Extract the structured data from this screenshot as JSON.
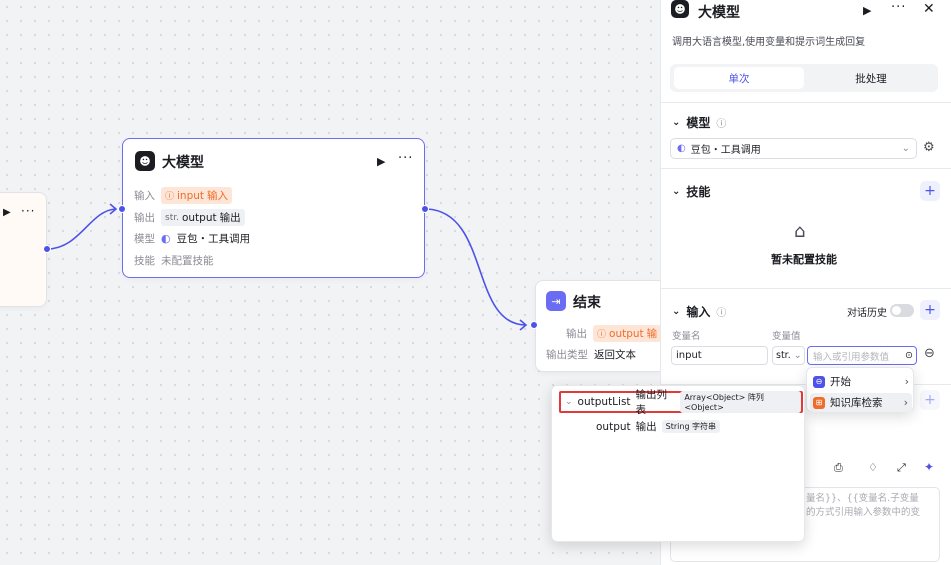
{
  "canvas": {
    "left_node": {
      "run_icon": "play-icon",
      "more_icon": "more-icon"
    },
    "llm_node": {
      "title": "大模型",
      "input_label": "输入",
      "input_tag": "input",
      "input_value": "输入",
      "output_label": "输出",
      "output_type": "str.",
      "output_name": "output",
      "output_value": "输出",
      "model_label": "模型",
      "model_value": "豆包・工具调用",
      "skill_label": "技能",
      "skill_value": "未配置技能"
    },
    "end_node": {
      "title": "结束",
      "output_label": "输出",
      "output_tag": "output",
      "output_value": "输",
      "output_type_label": "输出类型",
      "output_type_value": "返回文本"
    },
    "output_popup": {
      "items": [
        {
          "name": "outputList",
          "desc": "输出列表",
          "type": "Array<Object> 阵列<Object>"
        },
        {
          "name": "output",
          "desc": "输出",
          "type": "String 字符串"
        }
      ]
    }
  },
  "panel": {
    "title": "大模型",
    "description": "调用大语言模型,使用变量和提示词生成回复",
    "tabs": [
      "单次",
      "批处理"
    ],
    "model_section": {
      "title": "模型",
      "selected": "豆包・工具调用"
    },
    "skills_section": {
      "title": "技能",
      "empty_text": "暂未配置技能"
    },
    "input_section": {
      "title": "输入",
      "history_label": "对话历史",
      "col_name": "变量名",
      "col_value": "变量值",
      "row": {
        "name": "input",
        "type": "str.",
        "placeholder": "输入或引用参数值"
      }
    },
    "ref_menu": {
      "items": [
        "开始",
        "知识库检索"
      ]
    },
    "prompt_partial_1": "量名}}、{{变量",
    "prompt_partial_2": "的方式引用输入参数中的变",
    "prompt_partial_prefix": "量名}}、{{变量名.子变量"
  }
}
